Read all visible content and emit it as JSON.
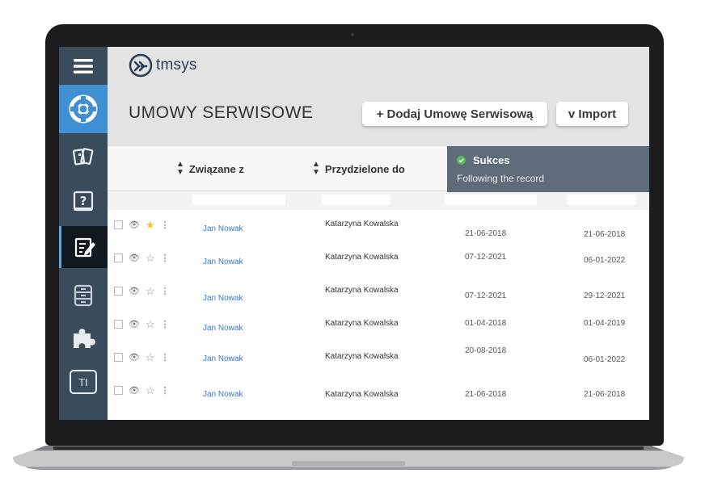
{
  "app": {
    "logo_text": "tmsys"
  },
  "sidebar": {
    "items": [
      {
        "icon": "hamburger-menu-icon"
      },
      {
        "icon": "lifebuoy-icon",
        "state": "active"
      },
      {
        "icon": "tickets-icon"
      },
      {
        "icon": "help-book-icon"
      },
      {
        "icon": "contract-edit-icon",
        "state": "selected"
      },
      {
        "icon": "archive-cabinet-icon"
      },
      {
        "icon": "puzzle-icon"
      },
      {
        "label": "TI"
      }
    ]
  },
  "header": {
    "title": "UMOWY SERWISOWE",
    "add_button": "+ Dodaj Umowę Serwisową",
    "import_button": "v Import"
  },
  "table": {
    "columns": [
      {
        "label": "Związane z"
      },
      {
        "label": "Przydzielone do"
      }
    ],
    "rows": [
      {
        "related": "Jan Nowak",
        "assigned": "Katarzyna Kowalska",
        "date1": "21-06-2018",
        "date2": "21-06-2018",
        "starred": true
      },
      {
        "related": "Jan Nowak",
        "assigned": "Katarzyna Kowalska",
        "date1": "07-12-2021",
        "date2": "06-01-2022",
        "starred": false
      },
      {
        "related": "Jan Nowak",
        "assigned": "Katarzyna Kowalska",
        "date1": "07-12-2021",
        "date2": "29-12-2021",
        "starred": false
      },
      {
        "related": "Jan Nowak",
        "assigned": "Katarzyna Kowalska",
        "date1": "01-04-2018",
        "date2": "01-04-2019",
        "starred": false
      },
      {
        "related": "Jan Nowak",
        "assigned": "Katarzyna Kowalska",
        "date1": "20-08-2018",
        "date2": "06-01-2022",
        "starred": false
      },
      {
        "related": "Jan Nowak",
        "assigned": "Katarzyna Kowalska",
        "date1": "21-06-2018",
        "date2": "21-06-2018",
        "starred": false
      }
    ]
  },
  "toast": {
    "title": "Sukces",
    "message": "Following the record",
    "close": "×"
  },
  "colors": {
    "sidebar": "#3a4b5c",
    "accent": "#3f8fd2",
    "link": "#3878c7",
    "star_active": "#f1c232",
    "toast_bg": "#5e6b78",
    "toast_success": "#5cb85c"
  }
}
